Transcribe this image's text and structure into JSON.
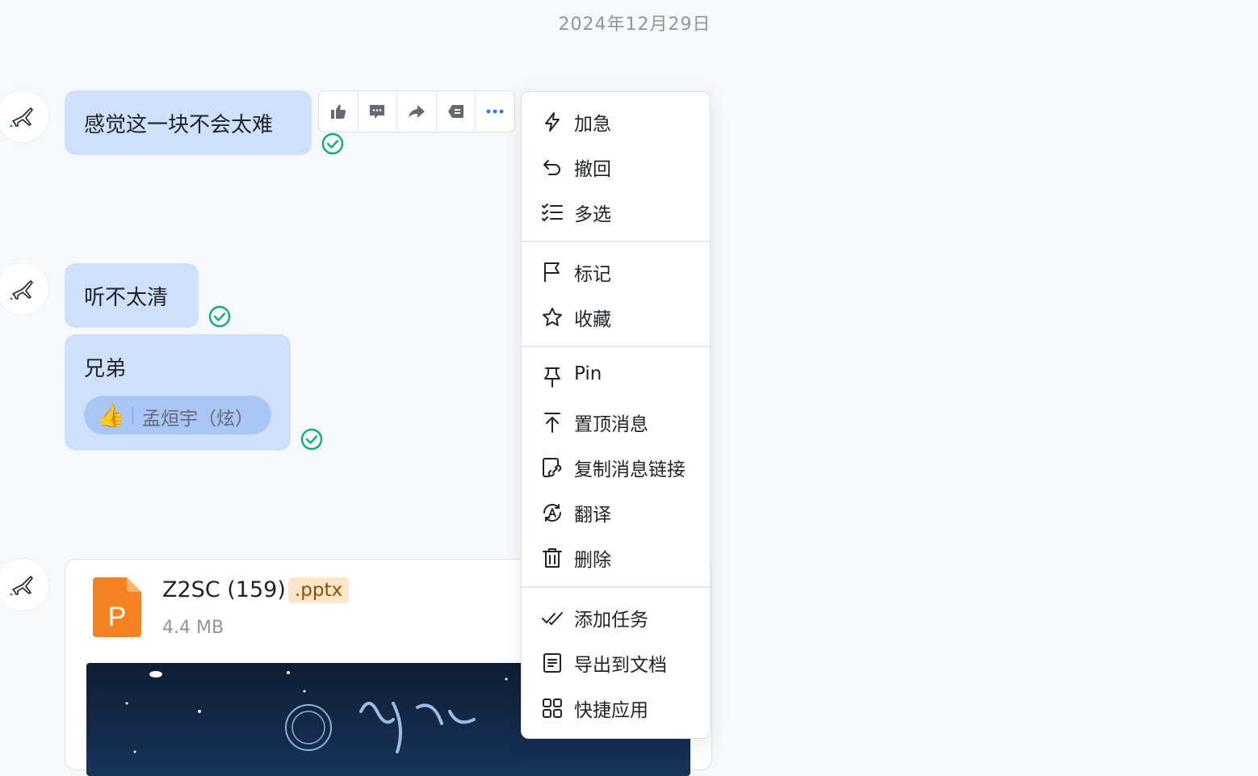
{
  "date_label": "2024年12月29日",
  "messages": [
    {
      "text": "感觉这一块不会太难"
    },
    {
      "text": "听不太清"
    },
    {
      "text": "兄弟",
      "reaction": {
        "emoji": "👍",
        "user": "孟烜宇（炫）"
      }
    }
  ],
  "file": {
    "name": "Z2SC (159)",
    "extension": ".pptx",
    "size": "4.4 MB",
    "icon_letter": "P"
  },
  "toolbar": {
    "icons": [
      "thumbs-up-icon",
      "comment-icon",
      "forward-icon",
      "quote-reply-icon",
      "more-icon"
    ]
  },
  "context_menu": {
    "groups": [
      [
        {
          "label": "加急",
          "icon": "urgent-icon"
        },
        {
          "label": "撤回",
          "icon": "undo-icon"
        },
        {
          "label": "多选",
          "icon": "multi-select-icon"
        }
      ],
      [
        {
          "label": "标记",
          "icon": "flag-icon"
        },
        {
          "label": "收藏",
          "icon": "star-icon"
        }
      ],
      [
        {
          "label": "Pin",
          "icon": "pin-icon"
        },
        {
          "label": "置顶消息",
          "icon": "pin-to-top-icon"
        },
        {
          "label": "复制消息链接",
          "icon": "copy-link-icon"
        },
        {
          "label": "翻译",
          "icon": "translate-icon"
        },
        {
          "label": "删除",
          "icon": "trash-icon"
        }
      ],
      [
        {
          "label": "添加任务",
          "icon": "add-task-icon"
        },
        {
          "label": "导出到文档",
          "icon": "export-doc-icon"
        },
        {
          "label": "快捷应用",
          "icon": "quick-apps-icon"
        }
      ]
    ]
  },
  "colors": {
    "bubble": "#cfe0fb",
    "check": "#14a87e",
    "accent": "#3370ff",
    "ppt": "#f58220"
  }
}
